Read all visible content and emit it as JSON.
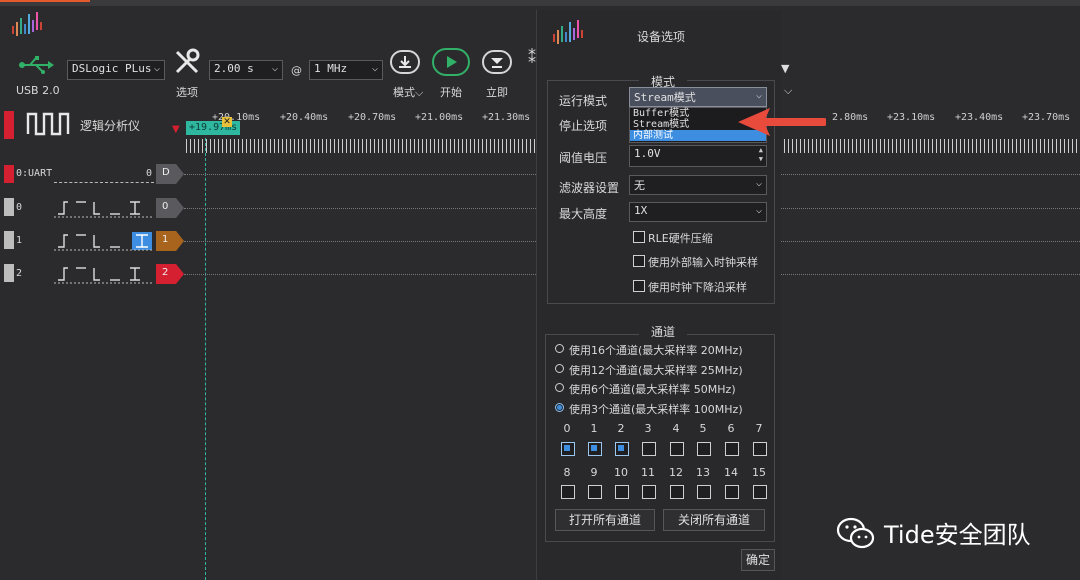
{
  "colors": {
    "accent_blue": "#3d8ee0",
    "play_green": "#31b067",
    "channel_red": "#d42030",
    "channel_orange": "#a8631c",
    "trigger_teal": "#2eb8a0",
    "arrow_red": "#e84b3c"
  },
  "toolbar": {
    "usb_label": "USB 2.0",
    "device_select": "DSLogic PLus",
    "options_label": "选项",
    "duration_select": "2.00 s",
    "at_sign": "@",
    "rate_select": "1 MHz",
    "mode_label": "模式",
    "start_label": "开始",
    "instant_label": "立即"
  },
  "analyzer": {
    "title": "逻辑分析仪",
    "trigger_time": "+19.97ms",
    "ruler_ticks": [
      "+20.10ms",
      "+20.40ms",
      "+20.70ms",
      "+21.00ms",
      "+21.30ms",
      "+22.80ms",
      "+23.10ms",
      "+23.40ms",
      "+23.70ms"
    ]
  },
  "channels": [
    {
      "name": "0:UART",
      "value": "0",
      "tag": "D"
    },
    {
      "name": "0",
      "tag": "0"
    },
    {
      "name": "1",
      "tag": "1"
    },
    {
      "name": "2",
      "tag": "2"
    }
  ],
  "dialog": {
    "title": "设备选项",
    "mode_group": "模式",
    "run_mode_label": "运行模式",
    "run_mode_value": "Stream模式",
    "run_mode_options": [
      "Buffer模式",
      "Stream模式",
      "内部测试"
    ],
    "stop_label": "停止选项",
    "threshold_label": "阈值电压",
    "threshold_value": "1.0V",
    "filter_label": "滤波器设置",
    "filter_value": "无",
    "max_height_label": "最大高度",
    "max_height_value": "1X",
    "rle_label": "RLE硬件压缩",
    "ext_clock_label": "使用外部输入时钟采样",
    "falling_edge_label": "使用时钟下降沿采样",
    "channel_group": "通道",
    "channel_modes": [
      {
        "label": "使用16个通道(最大采样率 20MHz)",
        "selected": false
      },
      {
        "label": "使用12个通道(最大采样率 25MHz)",
        "selected": false
      },
      {
        "label": "使用6个通道(最大采样率 50MHz)",
        "selected": false
      },
      {
        "label": "使用3个通道(最大采样率 100MHz)",
        "selected": true
      }
    ],
    "channel_numbers_row1": [
      "0",
      "1",
      "2",
      "3",
      "4",
      "5",
      "6",
      "7"
    ],
    "channel_numbers_row2": [
      "8",
      "9",
      "10",
      "11",
      "12",
      "13",
      "14",
      "15"
    ],
    "channels_checked_row1": [
      true,
      true,
      true,
      false,
      false,
      false,
      false,
      false
    ],
    "open_all": "打开所有通道",
    "close_all": "关闭所有通道",
    "ok": "确定"
  },
  "watermark": "Tide安全团队"
}
